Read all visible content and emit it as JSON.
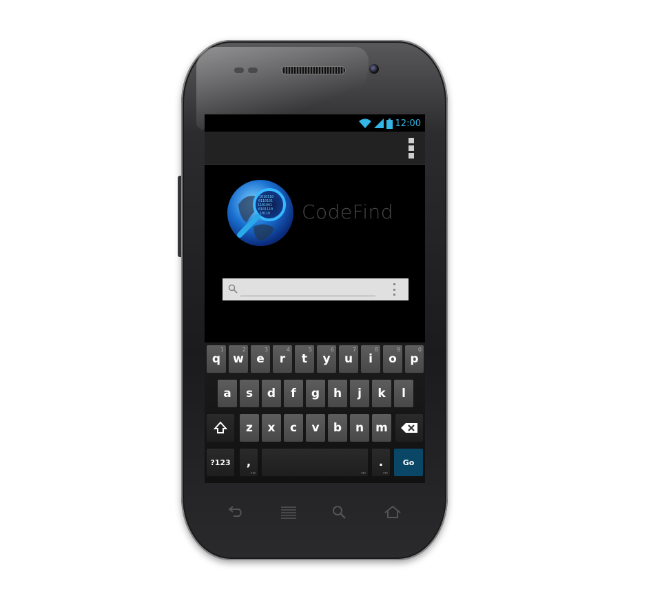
{
  "status_bar": {
    "time": "12:00",
    "icons": [
      "wifi-icon",
      "signal-icon",
      "battery-icon"
    ]
  },
  "action_bar": {
    "overflow_icon": "overflow-menu-icon"
  },
  "app": {
    "name": "CodeFind",
    "logo_icon": "globe-magnifier-logo"
  },
  "search": {
    "value": "",
    "placeholder": "",
    "icon": "search-icon"
  },
  "keyboard": {
    "row1": [
      {
        "key": "q",
        "hint": "1"
      },
      {
        "key": "w",
        "hint": "2"
      },
      {
        "key": "e",
        "hint": "3"
      },
      {
        "key": "r",
        "hint": "4"
      },
      {
        "key": "t",
        "hint": "5"
      },
      {
        "key": "y",
        "hint": "6"
      },
      {
        "key": "u",
        "hint": "7"
      },
      {
        "key": "i",
        "hint": "8"
      },
      {
        "key": "o",
        "hint": "9"
      },
      {
        "key": "p",
        "hint": "0"
      }
    ],
    "row2": [
      "a",
      "s",
      "d",
      "f",
      "g",
      "h",
      "j",
      "k",
      "l"
    ],
    "row3": [
      "z",
      "x",
      "c",
      "v",
      "b",
      "n",
      "m"
    ],
    "symbols_label": "?123",
    "comma_label": ",",
    "period_label": ".",
    "go_label": "Go"
  },
  "colors": {
    "status_accent": "#33b5e5",
    "go_key": "#0a4766",
    "screen_bg": "#000000",
    "action_bar_bg": "#222222"
  }
}
